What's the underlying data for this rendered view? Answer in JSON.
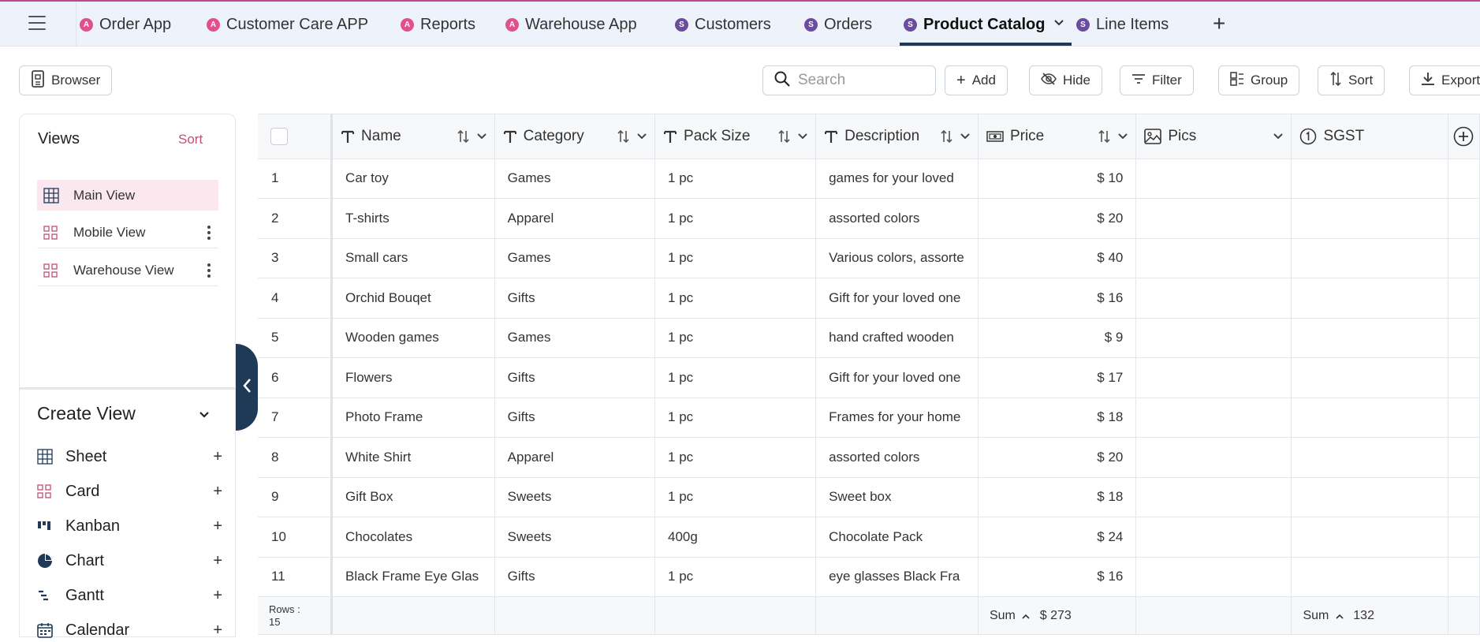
{
  "tabs": [
    {
      "label": "Order App",
      "type": "app",
      "badge": "A"
    },
    {
      "label": "Customer Care APP",
      "type": "app",
      "badge": "A"
    },
    {
      "label": "Reports",
      "type": "app",
      "badge": "A"
    },
    {
      "label": "Warehouse App",
      "type": "app",
      "badge": "A"
    },
    {
      "label": "Customers",
      "type": "sheet",
      "badge": "S"
    },
    {
      "label": "Orders",
      "type": "sheet",
      "badge": "S"
    },
    {
      "label": "Product Catalog",
      "type": "sheet",
      "badge": "S",
      "active": true
    },
    {
      "label": "Line Items",
      "type": "sheet",
      "badge": "S"
    }
  ],
  "add_tab": "+",
  "toolbar": {
    "browser_label": "Browser",
    "search_placeholder": "Search",
    "add_label": "Add",
    "hide_label": "Hide",
    "filter_label": "Filter",
    "group_label": "Group",
    "sort_label": "Sort",
    "export_label": "Export"
  },
  "views": {
    "title": "Views",
    "sort_label": "Sort",
    "items": [
      {
        "label": "Main View",
        "icon": "grid-icon",
        "active": true
      },
      {
        "label": "Mobile View",
        "icon": "card-icon"
      },
      {
        "label": "Warehouse View",
        "icon": "card-icon"
      }
    ]
  },
  "create_view": {
    "title": "Create View",
    "plus": "+",
    "items": [
      {
        "label": "Sheet",
        "icon": "sheet-icon"
      },
      {
        "label": "Card",
        "icon": "card-icon"
      },
      {
        "label": "Kanban",
        "icon": "kanban-icon"
      },
      {
        "label": "Chart",
        "icon": "chart-icon"
      },
      {
        "label": "Gantt",
        "icon": "gantt-icon"
      },
      {
        "label": "Calendar",
        "icon": "calendar-icon"
      }
    ]
  },
  "grid": {
    "columns": [
      {
        "label": "Name",
        "type": "text"
      },
      {
        "label": "Category",
        "type": "text"
      },
      {
        "label": "Pack Size",
        "type": "text"
      },
      {
        "label": "Description",
        "type": "text"
      },
      {
        "label": "Price",
        "type": "currency"
      },
      {
        "label": "Pics",
        "type": "image"
      },
      {
        "label": "SGST",
        "type": "number"
      }
    ],
    "rows": [
      {
        "n": "1",
        "name": "Car toy",
        "category": "Games",
        "pack": "1 pc",
        "desc": "games for your loved",
        "price": "$ 10"
      },
      {
        "n": "2",
        "name": "T-shirts",
        "category": "Apparel",
        "pack": "1 pc",
        "desc": "assorted colors",
        "price": "$ 20"
      },
      {
        "n": "3",
        "name": "Small cars",
        "category": "Games",
        "pack": "1 pc",
        "desc": "Various colors, assorte",
        "price": "$ 40"
      },
      {
        "n": "4",
        "name": "Orchid Bouqet",
        "category": "Gifts",
        "pack": "1 pc",
        "desc": "Gift for your loved one",
        "price": "$ 16"
      },
      {
        "n": "5",
        "name": "Wooden games",
        "category": "Games",
        "pack": "1 pc",
        "desc": "hand crafted wooden",
        "price": "$ 9"
      },
      {
        "n": "6",
        "name": "Flowers",
        "category": "Gifts",
        "pack": "1 pc",
        "desc": "Gift for your loved one",
        "price": "$ 17"
      },
      {
        "n": "7",
        "name": "Photo Frame",
        "category": "Gifts",
        "pack": "1 pc",
        "desc": "Frames for your home",
        "price": "$ 18"
      },
      {
        "n": "8",
        "name": "White Shirt",
        "category": "Apparel",
        "pack": "1 pc",
        "desc": "assorted colors",
        "price": "$ 20"
      },
      {
        "n": "9",
        "name": "Gift Box",
        "category": "Sweets",
        "pack": "1 pc",
        "desc": "Sweet box",
        "price": "$ 18"
      },
      {
        "n": "10",
        "name": "Chocolates",
        "category": "Sweets",
        "pack": "400g",
        "desc": "Chocolate Pack",
        "price": "$ 24"
      },
      {
        "n": "11",
        "name": "Black Frame Eye Glas",
        "category": "Gifts",
        "pack": "1 pc",
        "desc": "eye glasses Black Fra",
        "price": "$ 16"
      }
    ],
    "footer": {
      "rows_label": "Rows :",
      "rows_count": "15",
      "price_agg": "Sum",
      "price_sum": "$ 273",
      "sgst_agg": "Sum",
      "sgst_sum": "132"
    }
  },
  "colors": {
    "accent": "#c0507a",
    "navy": "#1e3a57",
    "app_badge": "#e2508a",
    "sheet_badge": "#6b4c9e"
  }
}
